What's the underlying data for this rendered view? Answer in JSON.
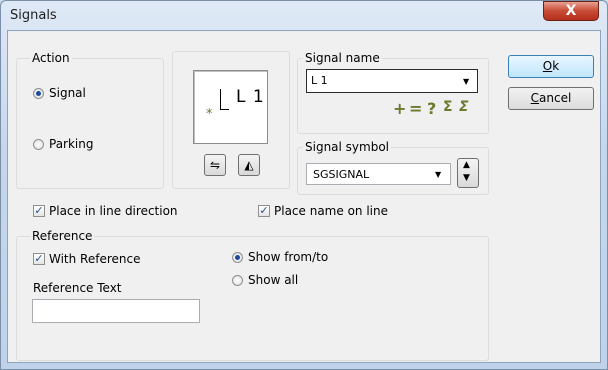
{
  "window": {
    "title": "Signals",
    "close_glyph": "X"
  },
  "action": {
    "group_label": "Action",
    "signal_label": "Signal",
    "parking_label": "Parking",
    "selected": "Signal"
  },
  "preview": {
    "text": "L 1",
    "marker": "*"
  },
  "preview_buttons": {
    "flip_icon": "flip-horizontal-icon",
    "mirror_icon": "mirror-icon"
  },
  "signal_name": {
    "group_label": "Signal name",
    "value": "L 1",
    "tools": [
      "+",
      "=",
      "?",
      "Σ",
      "Σ"
    ]
  },
  "signal_symbol": {
    "group_label": "Signal symbol",
    "value": "SGSIGNAL"
  },
  "options": {
    "place_in_line_direction": {
      "label": "Place in line direction",
      "checked": true
    },
    "place_name_on_line": {
      "label": "Place name on line",
      "checked": true
    }
  },
  "reference": {
    "group_label": "Reference",
    "with_reference": {
      "label": "With Reference",
      "checked": true
    },
    "text_label": "Reference Text",
    "text_value": "",
    "show_from_to": "Show from/to",
    "show_all": "Show all",
    "selected": "Show from/to"
  },
  "buttons": {
    "ok_first": "O",
    "ok_rest": "k",
    "cancel_first": "C",
    "cancel_rest": "ancel"
  },
  "colors": {
    "accent": "#1b4b9a",
    "close": "#c74a35",
    "tool": "#6b7a2c"
  }
}
